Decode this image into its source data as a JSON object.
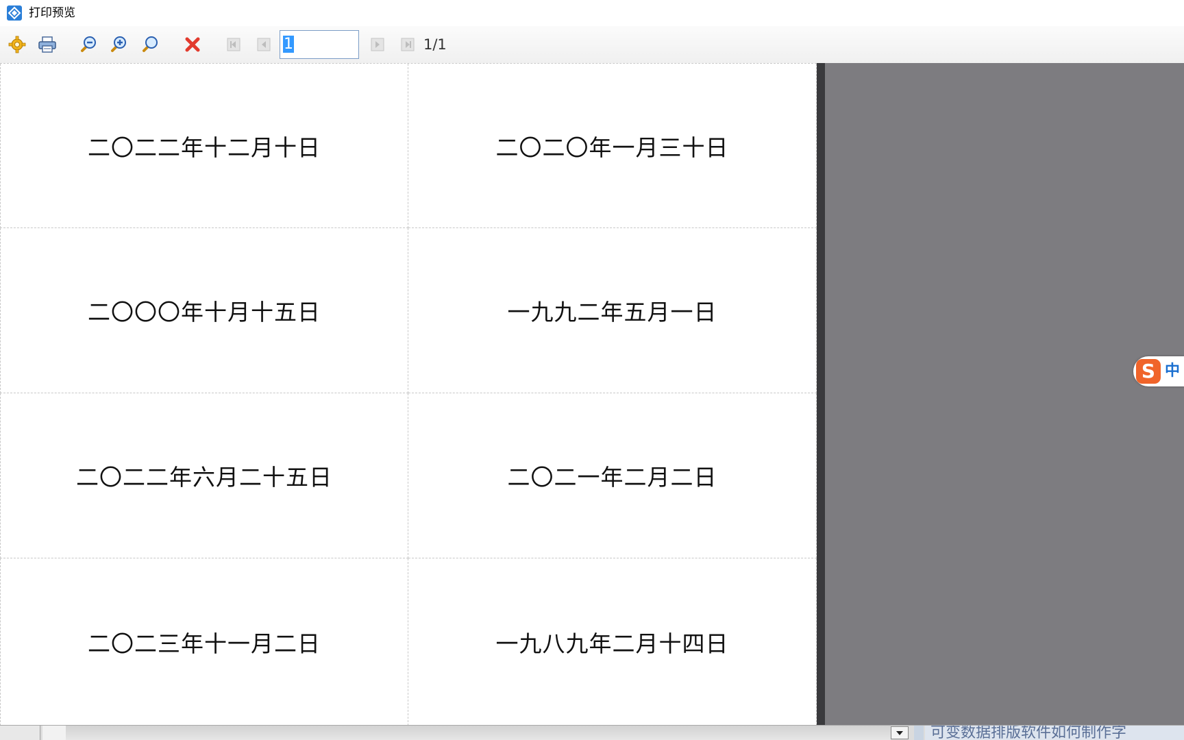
{
  "window": {
    "title": "打印预览",
    "icon": "app-logo-icon"
  },
  "toolbar": {
    "buttons": [
      {
        "name": "settings-gear-icon",
        "label": "设置"
      },
      {
        "name": "print-icon",
        "label": "打印"
      },
      {
        "name": "zoom-out-icon",
        "label": "缩小"
      },
      {
        "name": "zoom-in-icon",
        "label": "放大"
      },
      {
        "name": "zoom-fit-icon",
        "label": "适合"
      },
      {
        "name": "close-icon",
        "label": "关闭"
      },
      {
        "name": "first-page-icon",
        "label": "首页"
      },
      {
        "name": "prev-page-icon",
        "label": "上一页"
      },
      {
        "name": "next-page-icon",
        "label": "下一页"
      },
      {
        "name": "last-page-icon",
        "label": "末页"
      }
    ],
    "page_input_value": "1",
    "page_count": "1/1"
  },
  "labels": [
    "二〇二二年十二月十日",
    "二〇二〇年一月三十日",
    "二〇〇〇年十月十五日",
    "一九九二年五月一日",
    "二〇二二年六月二十五日",
    "二〇二一年二月二日",
    "二〇二三年十一月二日",
    "一九八九年二月十四日"
  ],
  "ime": {
    "logo": "S",
    "mode": "中"
  },
  "taskbar": {
    "text": "可变数据排版软件如何制作字"
  },
  "colors": {
    "preview_background": "#7d7c80",
    "page_background": "#ffffff",
    "close_red": "#e23b2e",
    "ime_orange": "#f0642a"
  }
}
